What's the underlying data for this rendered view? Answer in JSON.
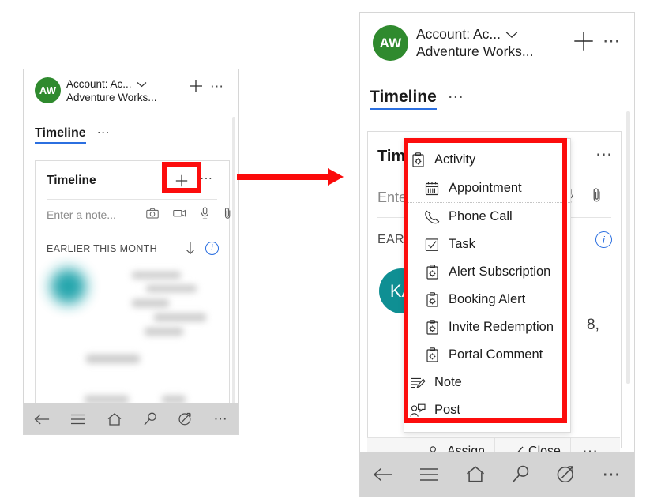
{
  "account": {
    "avatar_initials": "AW",
    "avatar_color": "#2f8a2e",
    "line1": "Account: Ac...",
    "line2": "Adventure Works...",
    "chevron_icon": "chevron-down-icon",
    "add_icon": "plus-icon",
    "overflow_icon": "ellipsis-icon"
  },
  "tabs": {
    "active": "Timeline",
    "overflow_icon": "ellipsis-icon",
    "underline_color": "#2b6fe0"
  },
  "timeline_card": {
    "title": "Timeline",
    "add_icon": "plus-icon",
    "overflow_icon": "ellipsis-icon",
    "note_placeholder": "Enter a note...",
    "note_icons": [
      "camera-icon",
      "video-icon",
      "microphone-icon",
      "attachment-icon"
    ],
    "section_label": "EARLIER THIS MONTH",
    "sort_icon": "arrow-down-icon",
    "info_icon": "info-icon",
    "record_avatar_initials": "KA",
    "record_avatar_color": "#0f8f93",
    "record_fragment": "8,"
  },
  "menu": {
    "items": [
      {
        "label": "Activity",
        "icon": "activity-icon",
        "indent": false,
        "separator": true
      },
      {
        "label": "Appointment",
        "icon": "calendar-icon",
        "indent": true,
        "separator": true
      },
      {
        "label": "Phone Call",
        "icon": "phone-icon",
        "indent": true,
        "separator": false
      },
      {
        "label": "Task",
        "icon": "checkbox-icon",
        "indent": true,
        "separator": false
      },
      {
        "label": "Alert Subscription",
        "icon": "activity-icon",
        "indent": true,
        "separator": false
      },
      {
        "label": "Booking Alert",
        "icon": "activity-icon",
        "indent": true,
        "separator": false
      },
      {
        "label": "Invite Redemption",
        "icon": "activity-icon",
        "indent": true,
        "separator": false
      },
      {
        "label": "Portal Comment",
        "icon": "activity-icon",
        "indent": true,
        "separator": false
      },
      {
        "label": "Note",
        "icon": "note-icon",
        "indent": false,
        "separator": false
      },
      {
        "label": "Post",
        "icon": "post-icon",
        "indent": false,
        "separator": false
      }
    ]
  },
  "command_bar": {
    "buttons": [
      {
        "label": "Assign",
        "icon": "assign-user-icon"
      },
      {
        "label": "Close",
        "icon": "check-icon"
      }
    ],
    "overflow_icon": "ellipsis-icon"
  },
  "bottom_nav": {
    "items": [
      "back-icon",
      "menu-icon",
      "home-icon",
      "search-icon",
      "compass-icon",
      "ellipsis-icon"
    ],
    "background": "#d4d4d4"
  },
  "annotation": {
    "highlight_color": "#fc0d0d",
    "arrow_icon": "arrow-right-icon"
  }
}
